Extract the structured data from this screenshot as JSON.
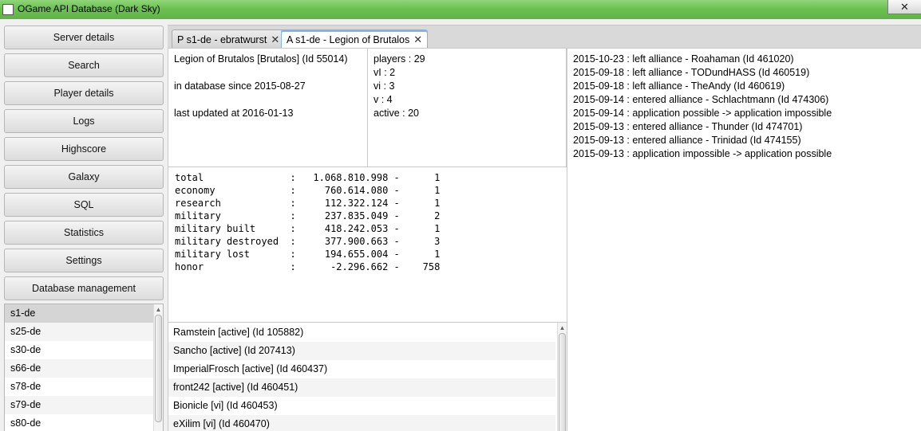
{
  "window": {
    "title": "OGame API Database (Dark Sky)",
    "close_glyph": "✕"
  },
  "nav": {
    "buttons": [
      "Server details",
      "Search",
      "Player details",
      "Logs",
      "Highscore",
      "Galaxy",
      "SQL",
      "Statistics",
      "Settings",
      "Database management"
    ]
  },
  "servers": {
    "items": [
      "s1-de",
      "s25-de",
      "s30-de",
      "s66-de",
      "s78-de",
      "s79-de",
      "s80-de"
    ],
    "selected": "s1-de",
    "scroll_up_glyph": "▲"
  },
  "tabs": [
    {
      "label": "P s1-de - ebratwurst",
      "close": "✕",
      "active": false
    },
    {
      "label": "A s1-de - Legion of Brutalos",
      "close": "✕",
      "active": true
    }
  ],
  "alliance": {
    "name_line": "Legion of Brutalos [Brutalos] (Id 55014)",
    "since_line": "in database since 2015-08-27",
    "updated_line": "last updated at 2016-01-13"
  },
  "counts": [
    "players : 29",
    "vI : 2",
    "vi : 3",
    "v : 4",
    "active : 20"
  ],
  "highscores": [
    "total               :   1.068.810.998 -      1",
    "economy             :     760.614.080 -      1",
    "research            :     112.322.124 -      1",
    "military            :     237.835.049 -      2",
    "military built      :     418.242.053 -      1",
    "military destroyed  :     377.900.663 -      3",
    "military lost       :     194.655.004 -      1",
    "honor               :      -2.296.662 -    758"
  ],
  "members": [
    "Ramstein [active] (Id 105882)",
    "Sancho [active] (Id 207413)",
    "ImperialFrosch [active] (Id 460437)",
    "front242 [active] (Id 460451)",
    "Bionicle [vi] (Id 460453)",
    "eXilim [vi] (Id 460470)"
  ],
  "log": [
    "2015-10-23 : left alliance - Roahaman (Id 461020)",
    "2015-09-18 : left alliance - TODundHASS (Id 460519)",
    "2015-09-18 : left alliance - TheAndy (Id 460619)",
    "2015-09-14 : entered alliance - Schlachtmann (Id 474306)",
    "2015-09-14 : application possible -> application impossible",
    "2015-09-13 : entered alliance - Thunder (Id 474701)",
    "2015-09-13 : entered alliance - Trinidad (Id 474155)",
    "2015-09-13 : application impossible -> application possible"
  ]
}
